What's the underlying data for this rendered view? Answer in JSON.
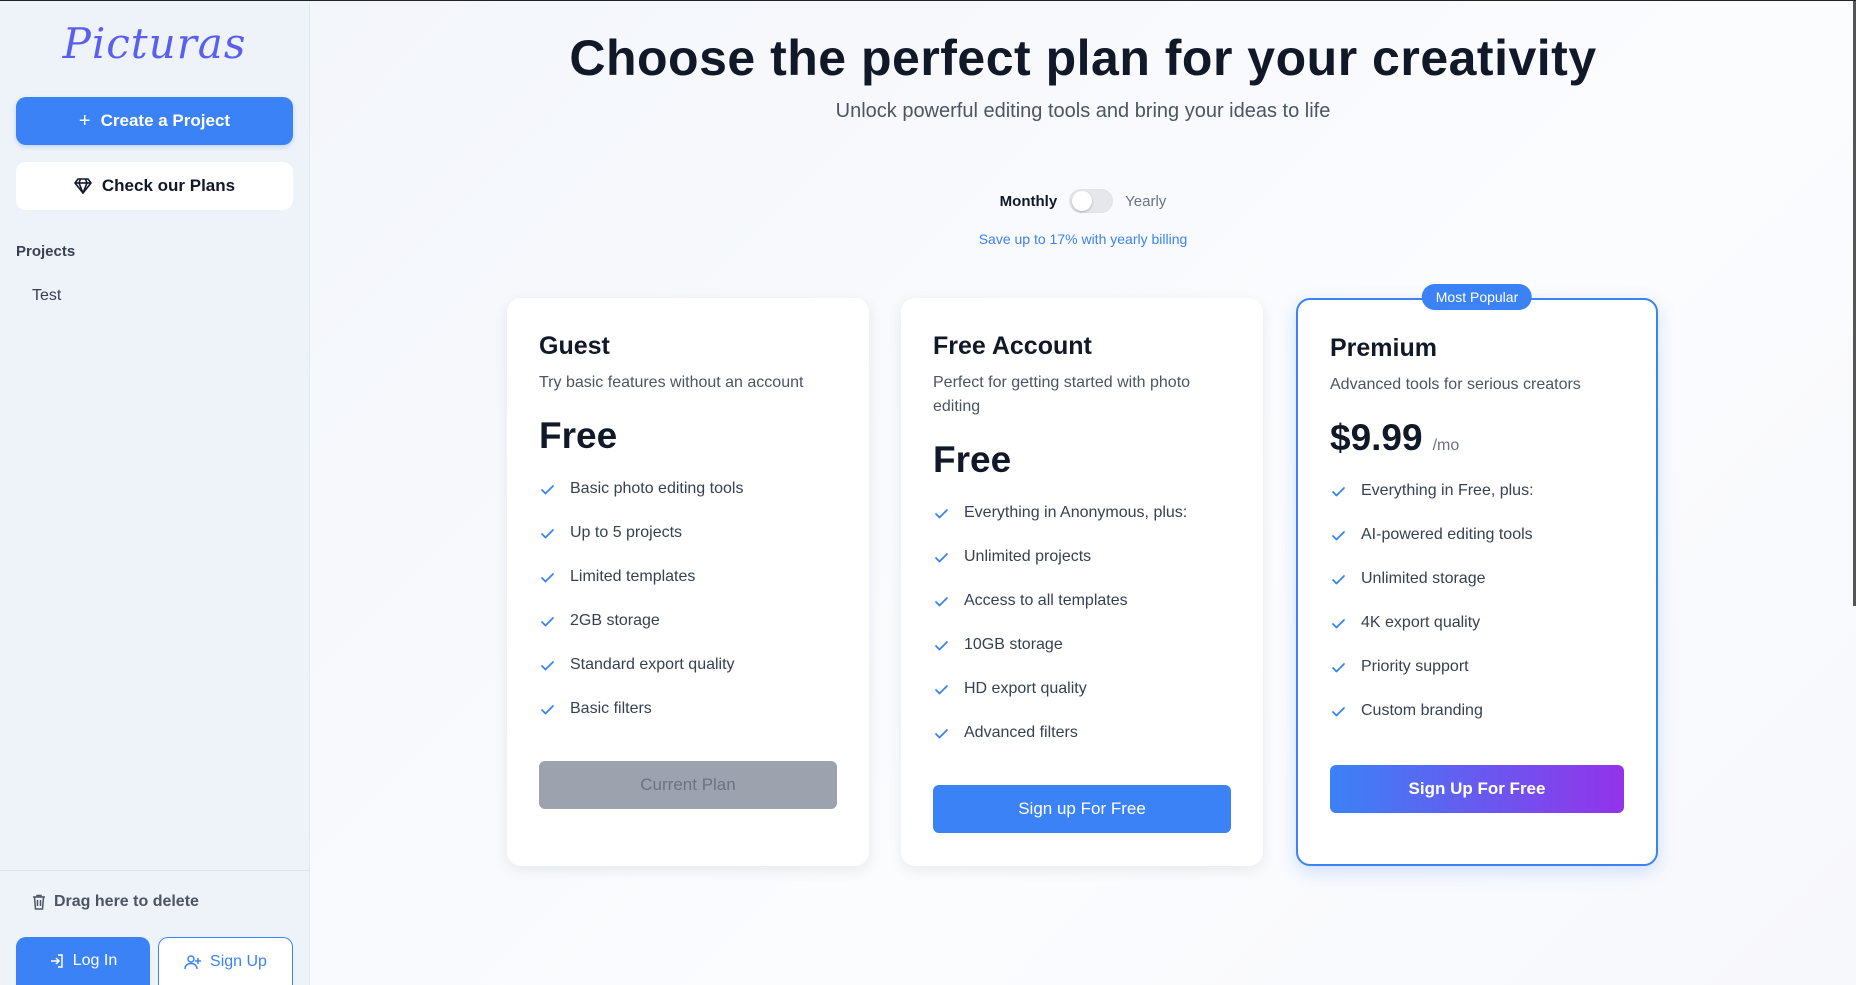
{
  "sidebar": {
    "logo": "Picturas",
    "create_project_label": "Create a Project",
    "check_plans_label": "Check our Plans",
    "projects_heading": "Projects",
    "projects": [
      {
        "name": "Test"
      }
    ],
    "drag_delete_label": "Drag here to delete",
    "login_label": "Log In",
    "signup_label": "Sign Up"
  },
  "header": {
    "title": "Choose the perfect plan for your creativity",
    "subtitle": "Unlock powerful editing tools and bring your ideas to life"
  },
  "billing": {
    "monthly_label": "Monthly",
    "yearly_label": "Yearly",
    "toggle_state": "monthly",
    "save_note": "Save up to 17% with yearly billing"
  },
  "plans": [
    {
      "name": "Guest",
      "description": "Try basic features without an account",
      "price": "Free",
      "period": "",
      "features": [
        "Basic photo editing tools",
        "Up to 5 projects",
        "Limited templates",
        "2GB storage",
        "Standard export quality",
        "Basic filters"
      ],
      "button_label": "Current Plan"
    },
    {
      "name": "Free Account",
      "description": "Perfect for getting started with photo editing",
      "price": "Free",
      "period": "",
      "features": [
        "Everything in Anonymous, plus:",
        "Unlimited projects",
        "Access to all templates",
        "10GB storage",
        "HD export quality",
        "Advanced filters"
      ],
      "button_label": "Sign up For Free"
    },
    {
      "name": "Premium",
      "badge": "Most Popular",
      "description": "Advanced tools for serious creators",
      "price": "$9.99",
      "period": "/mo",
      "features": [
        "Everything in Free, plus:",
        "AI-powered editing tools",
        "Unlimited storage",
        "4K export quality",
        "Priority support",
        "Custom branding"
      ],
      "button_label": "Sign Up For Free"
    }
  ],
  "colors": {
    "accent": "#3b82f6",
    "premium_gradient_end": "#9333ea",
    "sidebar_bg": "#eef2f9",
    "logo": "#5b5ff0"
  }
}
